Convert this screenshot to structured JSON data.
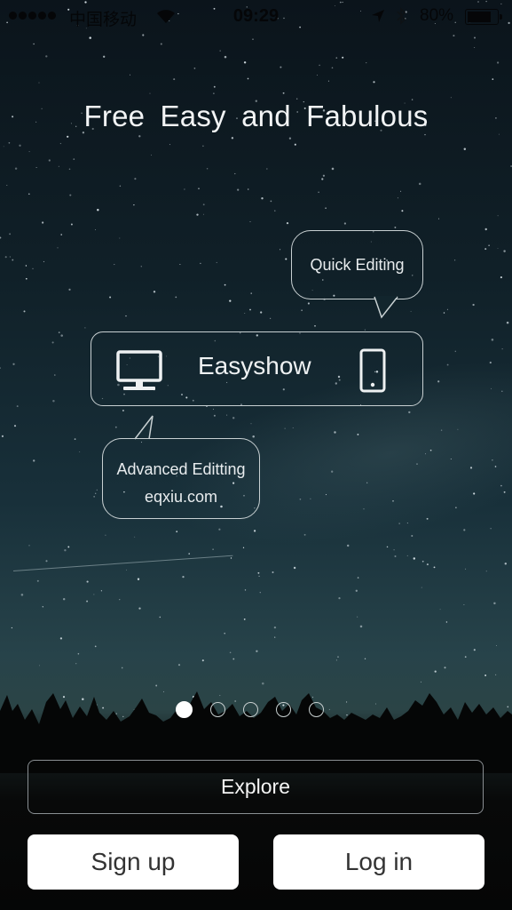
{
  "status_bar": {
    "signal_dots": 5,
    "carrier": "中国移动",
    "wifi_icon": "wifi-icon",
    "time": "09:29",
    "location_icon": "location-arrow-icon",
    "bluetooth_icon": "bluetooth-icon",
    "battery_percent_text": "80%",
    "battery_level": 0.8
  },
  "headline": "Free Easy and Fabulous",
  "bubbles": {
    "quick": "Quick Editing",
    "advanced_line1": "Advanced Editting",
    "advanced_line2": "eqxiu.com"
  },
  "brand_box": {
    "title": "Easyshow",
    "left_icon": "desktop-monitor-icon",
    "right_icon": "mobile-phone-icon"
  },
  "pager": {
    "count": 5,
    "active_index": 0
  },
  "buttons": {
    "explore": "Explore",
    "sign_up": "Sign up",
    "log_in": "Log in"
  },
  "colors": {
    "button_white": "#ffffff",
    "button_text_dark": "#333333",
    "outline": "#c8d0d2"
  }
}
